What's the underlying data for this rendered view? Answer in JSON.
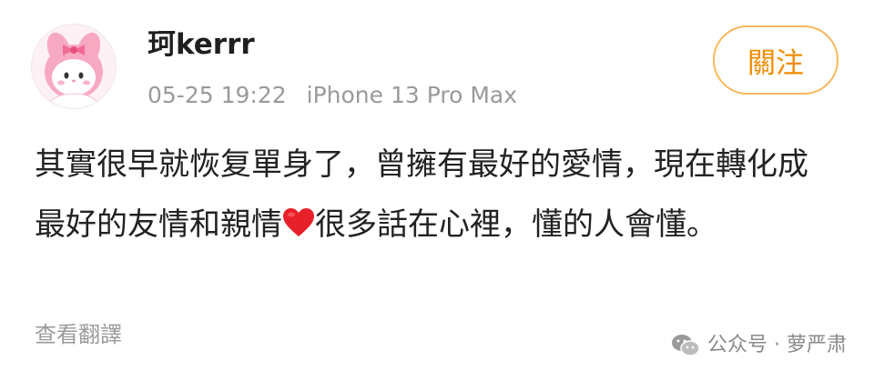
{
  "user": {
    "name": "珂kerrr",
    "date": "05-25 19:22",
    "device": "iPhone 13 Pro Max",
    "avatar_icon": "pink-bunny-avatar-icon"
  },
  "follow_button": {
    "label": "關注",
    "color": "#f28c00"
  },
  "post": {
    "text_before_heart": "其實很早就恢复單身了，曾擁有最好的愛情，現在轉化成最好的友情和親情",
    "heart_icon": "red-heart-icon",
    "text_after_heart": "很多話在心裡，懂的人會懂。"
  },
  "translate_label": "查看翻譯",
  "watermark": {
    "text": "公众号 · 萝严肃",
    "icon": "wechat-icon"
  }
}
